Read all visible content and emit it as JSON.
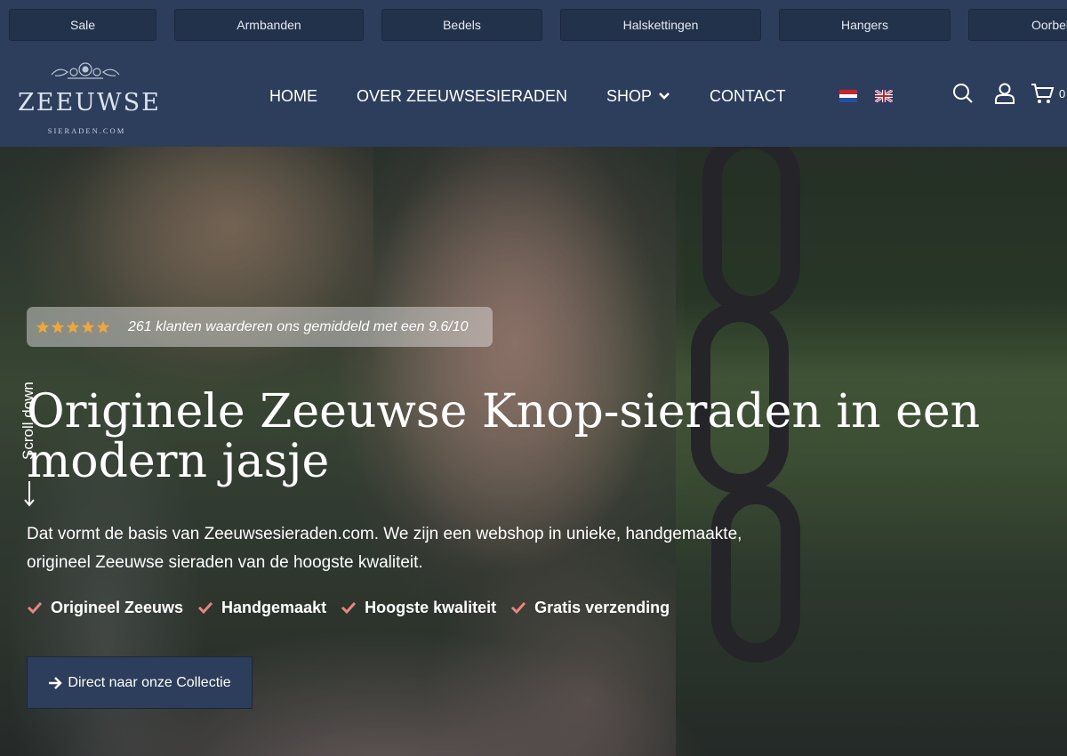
{
  "categories": [
    "Sale",
    "Armbanden",
    "Bedels",
    "Halskettingen",
    "Hangers",
    "Oorbellen"
  ],
  "logo": {
    "word": "ZEEUWSE",
    "sub": "SIERADEN.COM"
  },
  "nav": {
    "home": "HOME",
    "about": "OVER ZEEUWSESIERADEN",
    "shop": "SHOP",
    "contact": "CONTACT"
  },
  "languages": [
    "nl",
    "en"
  ],
  "header_icons": {
    "search": "search-icon",
    "account": "user-icon",
    "cart": "cart-icon"
  },
  "cart": {
    "count": "0"
  },
  "hero": {
    "rating_text": "261 klanten waarderen ons gemiddeld met een 9.6/10",
    "stars": 5,
    "scroll_label": "Scroll down",
    "title": "Originele Zeeuwse Knop-sieraden in een modern jasje",
    "subtitle": "Dat vormt de basis van Zeeuwsesieraden.com. We zijn een webshop in unieke, handgemaakte, origineel Zeeuwse sieraden van de hoogste kwaliteit.",
    "usps": [
      "Origineel Zeeuws",
      "Handgemaakt",
      "Hoogste kwaliteit",
      "Gratis verzending"
    ],
    "cta": "Direct naar onze Collectie"
  },
  "colors": {
    "header_bg": "#2c3e5c",
    "check": "#e8857d",
    "star": "#f0a73a"
  }
}
